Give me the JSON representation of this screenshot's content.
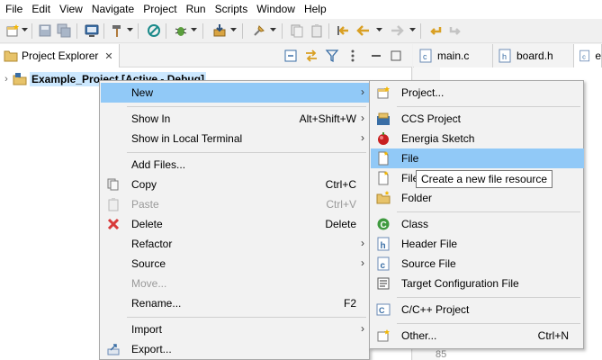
{
  "menubar": {
    "items": [
      "File",
      "Edit",
      "View",
      "Navigate",
      "Project",
      "Run",
      "Scripts",
      "Window",
      "Help"
    ]
  },
  "toolbar": {
    "icons": [
      "new-wizard-icon",
      "save-icon",
      "save-all-icon",
      "terminal-icon",
      "build-hammer-icon",
      "no-entry-icon",
      "debug-bug-icon",
      "flash-icon",
      "pin-icon",
      "copy-icon",
      "paste-icon",
      "back-arrow-icon",
      "forward-arrow-icon",
      "last-edit-icon"
    ]
  },
  "explorer": {
    "tab_label": "Project Explorer",
    "project_label": "Example_Project  [Active - Debug]"
  },
  "editor": {
    "tabs": [
      "main.c",
      "board.h",
      "e"
    ],
    "line_number": "85"
  },
  "context_menu": {
    "items": [
      {
        "label": "New",
        "shortcut": "",
        "submenu": true,
        "highlighted": true
      },
      {
        "label": "Show In",
        "shortcut": "Alt+Shift+W",
        "submenu": true
      },
      {
        "label": "Show in Local Terminal",
        "shortcut": "",
        "submenu": true
      },
      {
        "label": "Add Files...",
        "shortcut": ""
      },
      {
        "label": "Copy",
        "shortcut": "Ctrl+C"
      },
      {
        "label": "Paste",
        "shortcut": "Ctrl+V",
        "disabled": true
      },
      {
        "label": "Delete",
        "shortcut": "Delete"
      },
      {
        "label": "Refactor",
        "shortcut": "",
        "submenu": true
      },
      {
        "label": "Source",
        "shortcut": "",
        "submenu": true
      },
      {
        "label": "Move...",
        "shortcut": "",
        "disabled": true
      },
      {
        "label": "Rename...",
        "shortcut": "F2"
      },
      {
        "label": "Import",
        "shortcut": "",
        "submenu": true
      },
      {
        "label": "Export...",
        "shortcut": ""
      }
    ]
  },
  "new_submenu": {
    "items": [
      {
        "label": "Project...",
        "shortcut": ""
      },
      {
        "label": "CCS Project",
        "shortcut": ""
      },
      {
        "label": "Energia Sketch",
        "shortcut": ""
      },
      {
        "label": "File",
        "shortcut": "",
        "highlighted": true
      },
      {
        "label": "File",
        "shortcut": ""
      },
      {
        "label": "Folder",
        "shortcut": ""
      },
      {
        "label": "Class",
        "shortcut": ""
      },
      {
        "label": "Header File",
        "shortcut": ""
      },
      {
        "label": "Source File",
        "shortcut": ""
      },
      {
        "label": "Target Configuration File",
        "shortcut": ""
      },
      {
        "label": "C/C++ Project",
        "shortcut": ""
      },
      {
        "label": "Other...",
        "shortcut": "Ctrl+N"
      }
    ]
  },
  "tooltip": {
    "text": "Create a new file resource"
  },
  "colors": {
    "highlight": "#91c9f7",
    "selection": "#cce8ff",
    "menu_bg": "#f2f2f2"
  }
}
